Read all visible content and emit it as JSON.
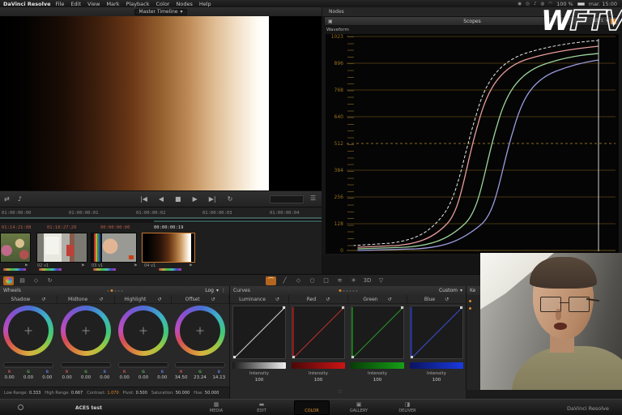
{
  "menu_bar": {
    "app": "DaVinci Resolve",
    "items": [
      "File",
      "Edit",
      "View",
      "Mark",
      "Playback",
      "Color",
      "Nodes",
      "Help"
    ],
    "battery": "100 %",
    "clock": "mar. 15:00"
  },
  "viewer": {
    "timeline_selector": "Master Timeline"
  },
  "ruler": {
    "ticks": [
      "01:00:00:00",
      "01:00:00:01",
      "01:00:00:02",
      "01:00:00:03",
      "01:00:00:04"
    ]
  },
  "timeline": {
    "clips": [
      {
        "timecode": "01:14:21:08",
        "label": ""
      },
      {
        "timecode": "01:10:27:20",
        "label": "02 v1"
      },
      {
        "timecode": "00:00:00:00",
        "label": "03 v1"
      },
      {
        "timecode": "00:00:00:19",
        "label": "04 v1"
      }
    ]
  },
  "scopes": {
    "panel_label": "Nodes",
    "title": "Scopes",
    "mode": "Waveform",
    "zoom_ratio": "10:1",
    "axis_labels": [
      "1023",
      "896",
      "768",
      "640",
      "512",
      "384",
      "256",
      "128",
      "0"
    ],
    "curves": "red, green and blue gamma S-curves rising from 0 to ~1000",
    "curve_colors": {
      "red": "#e89b9b",
      "green": "#9bd49b",
      "blue": "#9b9be0",
      "white": "#e8e8e8"
    }
  },
  "logo": {
    "solid": "W",
    "outline": "FTV"
  },
  "wheels": {
    "title": "Wheels",
    "mode": "Log",
    "rgb_letters": [
      "R",
      "G",
      "B"
    ],
    "tabs": [
      {
        "name": "Shadow",
        "values": [
          "0.00",
          "0.00",
          "0.00"
        ]
      },
      {
        "name": "Midtone",
        "values": [
          "0.00",
          "0.00",
          "0.00"
        ]
      },
      {
        "name": "Highlight",
        "values": [
          "0.00",
          "0.00",
          "0.00"
        ]
      },
      {
        "name": "Offset",
        "values": [
          "34.50",
          "23.24",
          "14.13"
        ]
      }
    ],
    "footer": [
      {
        "label": "Low Range:",
        "value": "0.333"
      },
      {
        "label": "High Range:",
        "value": "0.667"
      },
      {
        "label": "Contrast:",
        "value": "1.070"
      },
      {
        "label": "Pivot:",
        "value": "0.500"
      },
      {
        "label": "Saturation:",
        "value": "50.000"
      },
      {
        "label": "Hue:",
        "value": "50.000"
      }
    ]
  },
  "curves_palette": {
    "title": "Curves",
    "mode": "Custom",
    "intensity_label": "Intensity",
    "channels": [
      {
        "name": "Luminance",
        "intensity": "100"
      },
      {
        "name": "Red",
        "intensity": "100"
      },
      {
        "name": "Green",
        "intensity": "100"
      },
      {
        "name": "Blue",
        "intensity": "100"
      }
    ]
  },
  "keyframes": {
    "title": "Ke"
  },
  "bottom_bar": {
    "project": "ACES test",
    "pages": [
      {
        "label": "MEDIA"
      },
      {
        "label": "EDIT"
      },
      {
        "label": "COLOR"
      },
      {
        "label": "GALLERY"
      },
      {
        "label": "DELIVER"
      }
    ],
    "active_page": "COLOR",
    "app_name": "DaVinci Resolve"
  },
  "icons": {
    "dropdown": "▾",
    "menu_dots": "⋮",
    "reset": "↺",
    "detach": "▣",
    "flag": "⚑",
    "shuffle": "⇄",
    "audio": "♪",
    "jump_start": "|◀",
    "step_back": "◀",
    "stop": "■",
    "play": "▶",
    "step_fwd": "▶|",
    "loop": "↻",
    "list": "☰",
    "footer_dots": "∷",
    "page_media": "▦",
    "page_edit": "▬",
    "page_gallery": "▣",
    "page_deliver": "◨",
    "wheels_toolbar": [
      "▤",
      "◇",
      "↻"
    ],
    "curves_toolbar": [
      "╱",
      "◇",
      "○",
      "□",
      "≋",
      "✳",
      "3D",
      "▽"
    ]
  },
  "colors": {
    "accent_orange": "#e0862c",
    "selected_clip_border": "#c87830",
    "modified_value": "#e0862c",
    "timecode_red": "#b85c4a"
  }
}
